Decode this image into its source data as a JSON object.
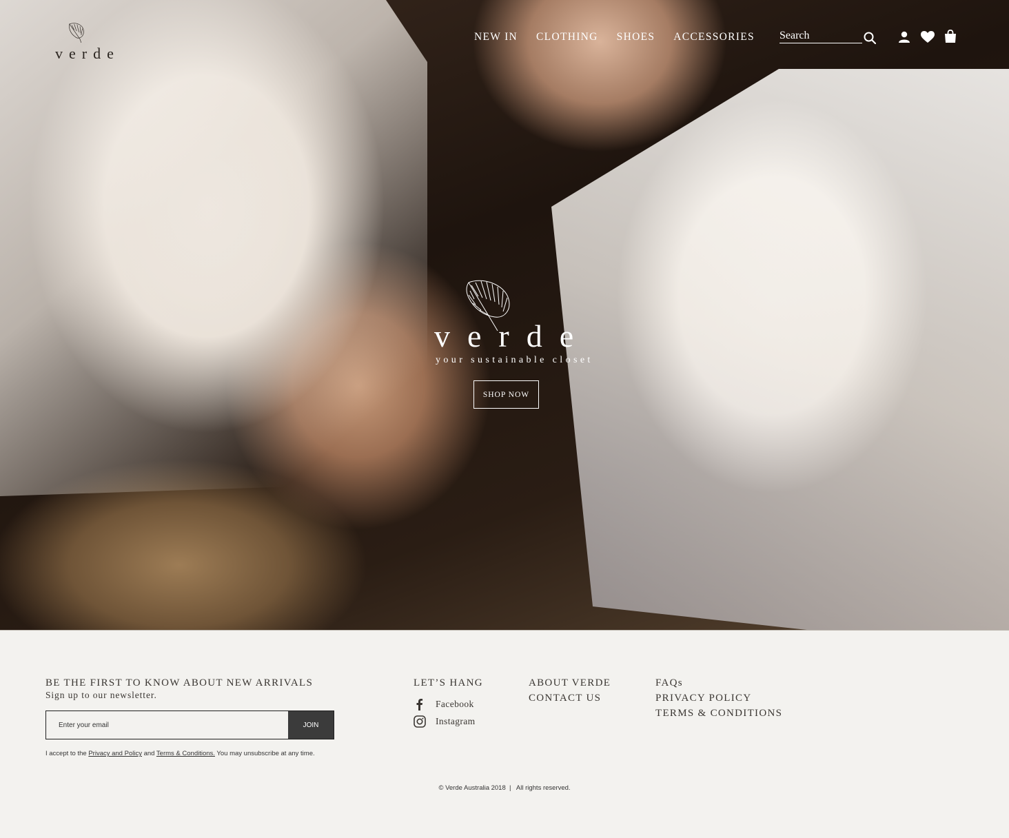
{
  "brand": {
    "name": "verde",
    "tagline": "your sustainable closet"
  },
  "nav": {
    "items": [
      "NEW IN",
      "CLOTHING",
      "SHOES",
      "ACCESSORIES"
    ],
    "search_placeholder": "Search"
  },
  "hero": {
    "cta_label": "SHOP NOW"
  },
  "newsletter": {
    "title": "BE THE FIRST TO KNOW ABOUT NEW ARRIVALS",
    "subtitle": "Sign up to our newsletter.",
    "email_placeholder": "Enter your email",
    "join_label": "JOIN",
    "consent_prefix": "I accept to the ",
    "consent_privacy": "Privacy and Policy",
    "consent_and": " and ",
    "consent_terms": "Terms & Conditions.",
    "consent_suffix": " You may unsubscribe at any time."
  },
  "social": {
    "title": "LET’S HANG",
    "facebook": "Facebook",
    "instagram": "Instagram"
  },
  "links_col1": {
    "about": "ABOUT VERDE",
    "contact": "CONTACT US"
  },
  "links_col2": {
    "faqs": "FAQs",
    "privacy": "PRIVACY POLICY",
    "terms": "TERMS & CONDITIONS"
  },
  "copyright": "© Verde Australia 2018  |   All rights reserved.",
  "colors": {
    "footer_bg": "#f3f2ef",
    "join_bg": "#3b3b3b",
    "text_dark": "#3a3632"
  }
}
